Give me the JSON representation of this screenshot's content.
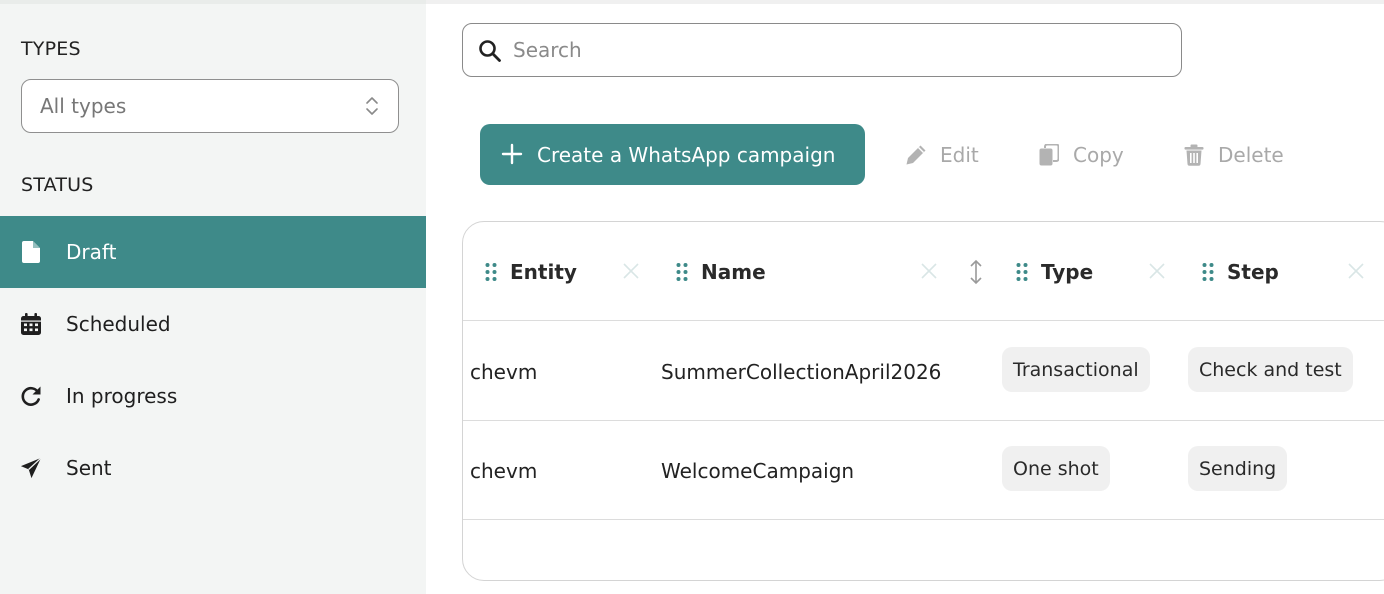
{
  "sidebar": {
    "types_heading": "TYPES",
    "type_select": {
      "value": "All types"
    },
    "status_heading": "STATUS",
    "status_items": [
      {
        "label": "Draft",
        "icon": "file-icon",
        "active": true
      },
      {
        "label": "Scheduled",
        "icon": "calendar-icon",
        "active": false
      },
      {
        "label": "In progress",
        "icon": "refresh-icon",
        "active": false
      },
      {
        "label": "Sent",
        "icon": "paper-plane-icon",
        "active": false
      }
    ]
  },
  "search": {
    "placeholder": "Search",
    "value": ""
  },
  "toolbar": {
    "create_label": "Create a WhatsApp campaign",
    "edit_label": "Edit",
    "copy_label": "Copy",
    "delete_label": "Delete"
  },
  "table": {
    "columns": [
      {
        "label": "Entity"
      },
      {
        "label": "Name"
      },
      {
        "label": "Type"
      },
      {
        "label": "Step"
      }
    ],
    "rows": [
      {
        "entity": "chevm",
        "name": "SummerCollectionApril2026",
        "type": "Transactional",
        "step": "Check and test"
      },
      {
        "entity": "chevm",
        "name": "WelcomeCampaign",
        "type": "One shot",
        "step": "Sending"
      }
    ]
  },
  "colors": {
    "accent": "#3e8a89",
    "sidebar_bg": "#f3f5f4",
    "disabled_text": "#a9a9a9",
    "pill_bg": "#f0f0f0"
  }
}
